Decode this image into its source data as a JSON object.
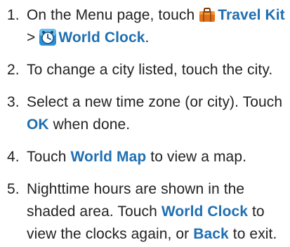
{
  "steps": [
    {
      "number": "1.",
      "segments": [
        {
          "type": "text",
          "value": "On the Menu page, touch "
        },
        {
          "type": "icon",
          "name": "travel-kit-suitcase-icon"
        },
        {
          "type": "bold",
          "value": "Travel Kit"
        },
        {
          "type": "text",
          "value": " > "
        },
        {
          "type": "icon",
          "name": "world-clock-icon"
        },
        {
          "type": "bold",
          "value": "World Clock"
        },
        {
          "type": "text",
          "value": "."
        }
      ]
    },
    {
      "number": "2.",
      "segments": [
        {
          "type": "text",
          "value": "To change a city listed, touch the city."
        }
      ]
    },
    {
      "number": "3.",
      "segments": [
        {
          "type": "text",
          "value": "Select a new time zone (or city). Touch "
        },
        {
          "type": "bold",
          "value": "OK"
        },
        {
          "type": "text",
          "value": " when done."
        }
      ]
    },
    {
      "number": "4.",
      "segments": [
        {
          "type": "text",
          "value": "Touch "
        },
        {
          "type": "bold",
          "value": "World Map"
        },
        {
          "type": "text",
          "value": " to view a map."
        }
      ]
    },
    {
      "number": "5.",
      "segments": [
        {
          "type": "text",
          "value": "Nighttime hours are shown in the shaded area. Touch "
        },
        {
          "type": "bold",
          "value": "World Clock"
        },
        {
          "type": "text",
          "value": " to view the clocks again, or "
        },
        {
          "type": "bold",
          "value": "Back"
        },
        {
          "type": "text",
          "value": " to exit."
        }
      ]
    }
  ],
  "colors": {
    "link_blue": "#1f6fb2",
    "body_text": "#222222",
    "suitcase_orange": "#e0701a",
    "clock_blue": "#2b8fd6"
  }
}
